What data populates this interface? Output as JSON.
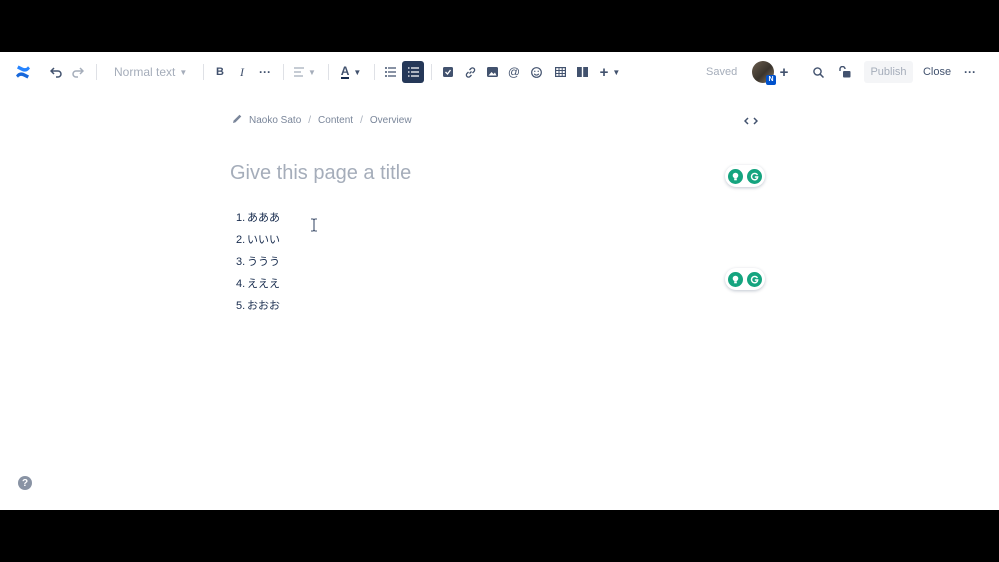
{
  "toolbar": {
    "text_style": "Normal text",
    "saved_label": "Saved",
    "publish_label": "Publish",
    "close_label": "Close",
    "avatar_badge": "N",
    "icons": [
      "confluence-logo-icon",
      "undo-icon",
      "redo-icon",
      "bold-icon",
      "italic-icon",
      "more-formatting-icon",
      "text-align-icon",
      "text-color-icon",
      "bullet-list-icon",
      "numbered-list-icon",
      "action-item-icon",
      "link-icon",
      "image-icon",
      "mention-icon",
      "emoji-icon",
      "table-icon",
      "layouts-icon",
      "insert-plus-icon",
      "search-icon",
      "restrictions-icon",
      "more-actions-icon"
    ]
  },
  "breadcrumb": {
    "items": [
      "Naoko Sato",
      "Content",
      "Overview"
    ]
  },
  "page": {
    "title_placeholder": "Give this page a title",
    "list": [
      {
        "num": "1.",
        "text": "あああ"
      },
      {
        "num": "2.",
        "text": "いいい"
      },
      {
        "num": "3.",
        "text": "ううう"
      },
      {
        "num": "4.",
        "text": "えええ"
      },
      {
        "num": "5.",
        "text": "おおお"
      }
    ]
  },
  "colors": {
    "accent": "#0052cc",
    "active_button": "#253858",
    "grammarly_green": "#15a47f",
    "text": "#172b4d",
    "muted": "#a5adba"
  }
}
